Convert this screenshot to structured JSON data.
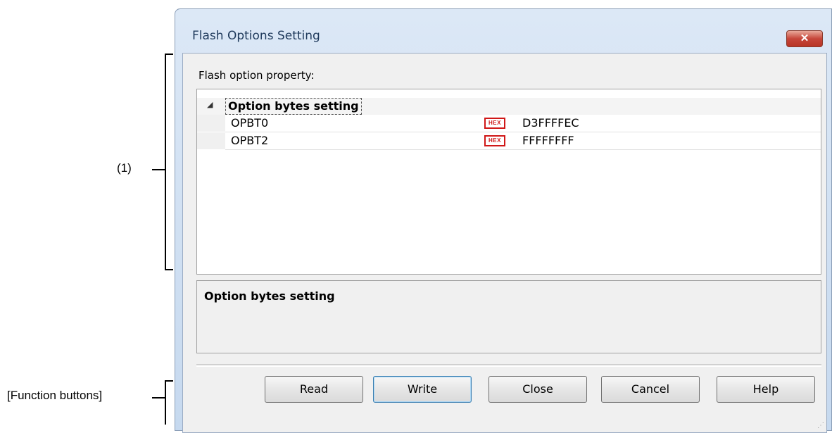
{
  "annotations": {
    "section_one": "(1)",
    "function_buttons": "[Function buttons]"
  },
  "window": {
    "title": "Flash Options Setting",
    "close_glyph": "✕"
  },
  "property_label": "Flash option property:",
  "grid": {
    "category": {
      "label": "Option bytes setting",
      "expander": "◢"
    },
    "rows": [
      {
        "name": "OPBT0",
        "badge": "HEX",
        "value": "D3FFFFEC"
      },
      {
        "name": "OPBT2",
        "badge": "HEX",
        "value": "FFFFFFFF"
      }
    ]
  },
  "description": {
    "title": "Option bytes setting"
  },
  "buttons": {
    "read": "Read",
    "write": "Write",
    "close": "Close",
    "cancel": "Cancel",
    "help": "Help"
  },
  "colors": {
    "hex_badge": "#d01818",
    "close_button": "#c6463a",
    "title_text": "#1e395b"
  }
}
